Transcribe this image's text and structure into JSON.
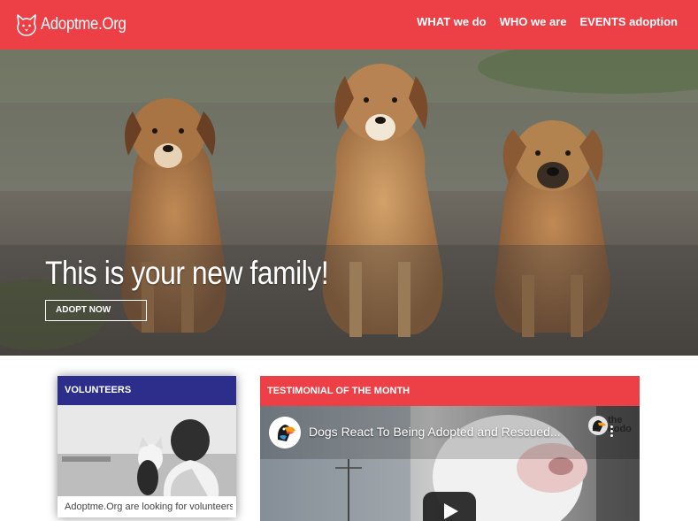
{
  "header": {
    "brand": "Adoptme.Org",
    "brand_icon": "cat-head-icon",
    "nav": [
      {
        "label": "WHAT we do"
      },
      {
        "label": "WHO we are"
      },
      {
        "label": "EVENTS adoption"
      }
    ],
    "bg_color": "#ec3f46"
  },
  "hero": {
    "title": "This is your new family!",
    "button_label": "ADOPT NOW",
    "image": "three-puppies-photo"
  },
  "volunteers": {
    "title": "VOLUNTEERS",
    "header_color": "#2d2e8c",
    "image": "girl-holding-cat-photo",
    "text": "Adoptme.Org are looking for volunteers"
  },
  "testimonial": {
    "title": "TESTIMONIAL OF THE MONTH",
    "header_color": "#ec3f46",
    "video": {
      "title": "Dogs React To Being Adopted and Rescued...",
      "channel_logo": "the dodo",
      "channel_icon": "toucan-icon",
      "play_icon": "play-icon",
      "menu_icon": "more-vertical-icon"
    }
  }
}
